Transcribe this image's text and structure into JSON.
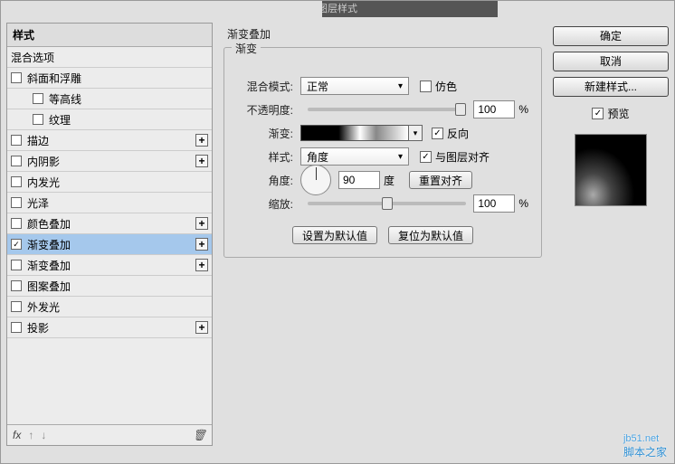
{
  "title": "图层样式",
  "left": {
    "header": "样式",
    "subheader": "混合选项",
    "items": [
      {
        "label": "斜面和浮雕",
        "plus": false,
        "sub": false
      },
      {
        "label": "等高线",
        "plus": false,
        "sub": true
      },
      {
        "label": "纹理",
        "plus": false,
        "sub": true
      },
      {
        "label": "描边",
        "plus": true,
        "sub": false
      },
      {
        "label": "内阴影",
        "plus": true,
        "sub": false
      },
      {
        "label": "内发光",
        "plus": false,
        "sub": false
      },
      {
        "label": "光泽",
        "plus": false,
        "sub": false
      },
      {
        "label": "颜色叠加",
        "plus": true,
        "sub": false
      },
      {
        "label": "渐变叠加",
        "plus": true,
        "sub": false,
        "checked": true,
        "selected": true
      },
      {
        "label": "渐变叠加",
        "plus": true,
        "sub": false
      },
      {
        "label": "图案叠加",
        "plus": false,
        "sub": false
      },
      {
        "label": "外发光",
        "plus": false,
        "sub": false
      },
      {
        "label": "投影",
        "plus": true,
        "sub": false
      }
    ],
    "footer_fx": "fx"
  },
  "panel": {
    "title": "渐变叠加",
    "group": "渐变",
    "blend_label": "混合模式:",
    "blend_value": "正常",
    "dither_label": "仿色",
    "opacity_label": "不透明度:",
    "opacity_value": "100",
    "percent": "%",
    "gradient_label": "渐变:",
    "reverse_label": "反向",
    "style_label": "样式:",
    "style_value": "角度",
    "align_label": "与图层对齐",
    "angle_label": "角度:",
    "angle_value": "90",
    "angle_unit": "度",
    "reset_align": "重置对齐",
    "scale_label": "缩放:",
    "scale_value": "100",
    "btn_default": "设置为默认值",
    "btn_reset": "复位为默认值"
  },
  "right": {
    "ok": "确定",
    "cancel": "取消",
    "new_style": "新建样式...",
    "preview": "预览"
  },
  "watermark": {
    "site": "脚本之家",
    "url": "jb51.net"
  }
}
